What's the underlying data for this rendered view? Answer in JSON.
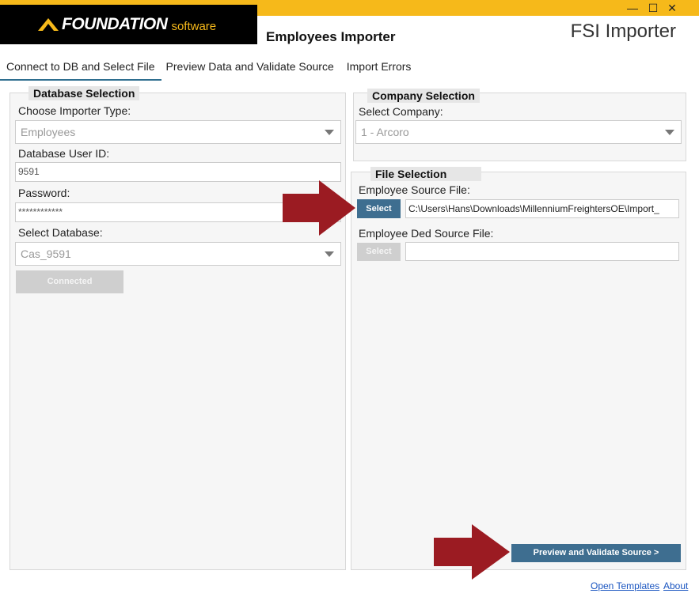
{
  "window": {
    "minimize_glyph": "—",
    "maximize_glyph": "☐",
    "close_glyph": "✕"
  },
  "brand": {
    "name": "FOUNDATION",
    "suffix": "software",
    "accent_color": "#f6b91a"
  },
  "header": {
    "title": "Employees Importer",
    "product": "FSI Importer"
  },
  "tabs": [
    {
      "label": "Connect to DB and Select File",
      "active": true
    },
    {
      "label": "Preview Data and Validate Source",
      "active": false
    },
    {
      "label": "Import Errors",
      "active": false
    }
  ],
  "database_selection": {
    "title": "Database Selection",
    "importer_type_label": "Choose Importer Type:",
    "importer_type_value": "Employees",
    "user_id_label": "Database User ID:",
    "user_id_value": "9591",
    "password_label": "Password:",
    "password_value": "************",
    "database_label": "Select Database:",
    "database_value": "Cas_9591",
    "connect_button": "Connected"
  },
  "company_selection": {
    "title": "Company Selection",
    "company_label": "Select Company:",
    "company_value": "1 - Arcoro"
  },
  "file_selection": {
    "title": "File Selection",
    "employee_source_label": "Employee Source File:",
    "employee_source_button": "Select",
    "employee_source_value": "C:\\Users\\Hans\\Downloads\\MillenniumFreightersOE\\Import_",
    "ded_source_label": "Employee Ded Source File:",
    "ded_source_button": "Select",
    "ded_source_value": ""
  },
  "actions": {
    "preview_button": "Preview and Validate Source >"
  },
  "footer": {
    "open_templates": "Open Templates",
    "about": "About"
  },
  "colors": {
    "annotation_arrow": "#9b1b22",
    "primary_button": "#3e6e90"
  }
}
